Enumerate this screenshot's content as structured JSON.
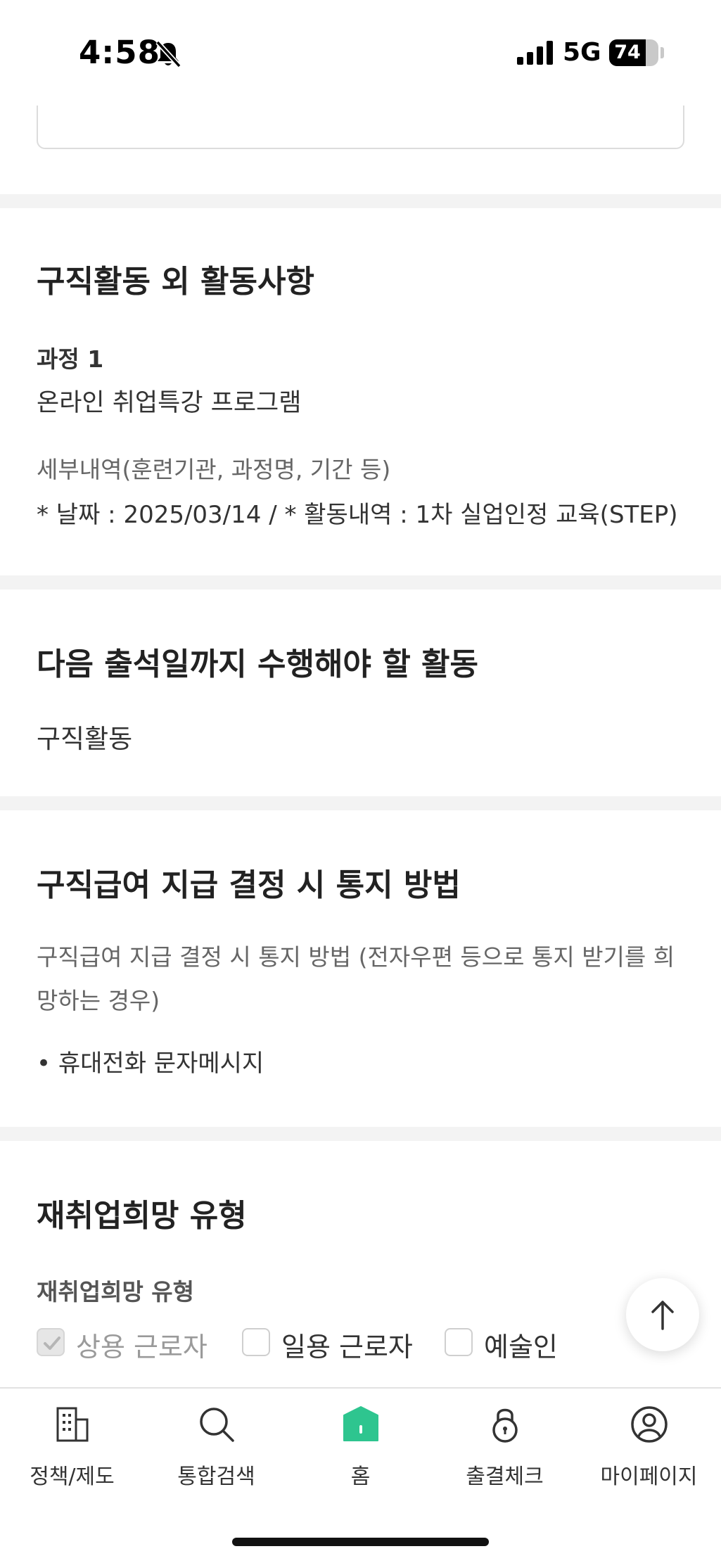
{
  "status_bar": {
    "time": "4:58",
    "network": "5G",
    "battery": "74",
    "battery_level": 0.74
  },
  "sections": {
    "other_activities": {
      "title": "구직활동 외 활동사항",
      "course_label": "과정 1",
      "course_name": "온라인 취업특강 프로그램",
      "detail_label": "세부내역(훈련기관, 과정명, 기간 등)",
      "detail_value": "* 날짜 : 2025/03/14 / * 활동내역 : 1차 실업인정 교육(STEP)"
    },
    "next_activity": {
      "title": "다음 출석일까지 수행해야 할 활동",
      "value": "구직활동"
    },
    "notification": {
      "title": "구직급여 지급 결정 시 통지 방법",
      "description": "구직급여 지급 결정 시 통지 방법 (전자우편 등으로 통지 받기를 희망하는 경우)",
      "selected": "휴대전화 문자메시지"
    },
    "reemployment": {
      "title": "재취업희망 유형",
      "label": "재취업희망 유형",
      "options": [
        {
          "label": "상용 근로자",
          "checked": true,
          "disabled": true
        },
        {
          "label": "일용 근로자",
          "checked": false,
          "disabled": false
        },
        {
          "label": "예술인",
          "checked": false,
          "disabled": false
        }
      ]
    }
  },
  "bottom_nav": {
    "items": [
      {
        "label": "정책/제도",
        "icon": "building-icon"
      },
      {
        "label": "통합검색",
        "icon": "search-icon"
      },
      {
        "label": "홈",
        "icon": "home-icon"
      },
      {
        "label": "출결체크",
        "icon": "lock-icon"
      },
      {
        "label": "마이페이지",
        "icon": "user-icon"
      }
    ]
  },
  "colors": {
    "accent": "#2ec58f",
    "divider": "#f3f3f3",
    "text": "#222222"
  }
}
